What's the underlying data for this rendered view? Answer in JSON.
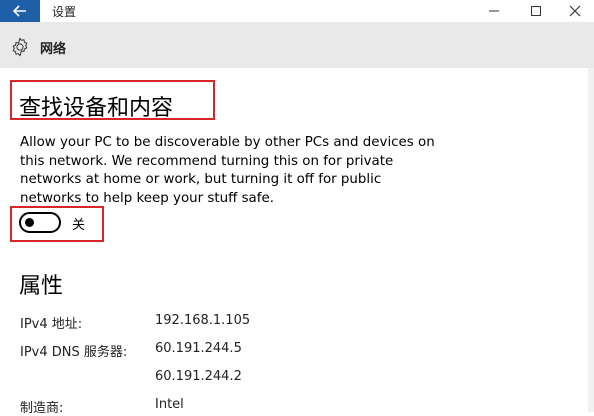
{
  "window": {
    "title": "设置",
    "controls": {
      "minimize": "−",
      "maximize": "□",
      "close": "✕"
    }
  },
  "header": {
    "icon": "gear-icon",
    "title": "网络"
  },
  "discovery": {
    "title": "查找设备和内容",
    "description": "Allow your PC to be discoverable by other PCs and devices on this network. We recommend turning this on for private networks at home or work, but turning it off for public networks to help keep your stuff safe.",
    "toggle_state": "关",
    "toggle_on": false
  },
  "properties": {
    "title": "属性",
    "rows": [
      {
        "label": "IPv4 地址:",
        "value": "192.168.1.105"
      },
      {
        "label": "IPv4 DNS 服务器:",
        "value": "60.191.244.5"
      },
      {
        "label": "",
        "value": "60.191.244.2"
      },
      {
        "label": "制造商:",
        "value": "Intel"
      }
    ]
  },
  "colors": {
    "accent": "#1f5fa8",
    "header_bg": "#e9e9e9",
    "highlight": "#d9242a"
  }
}
